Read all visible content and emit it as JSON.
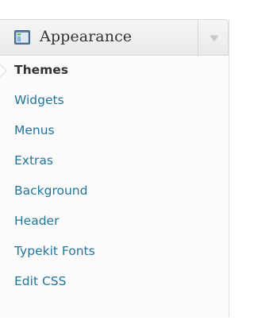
{
  "menu": {
    "title": "Appearance",
    "icon": "appearance-icon",
    "toggle_icon": "chevron-down-icon",
    "colors": {
      "link": "#21759b",
      "current": "#333333",
      "header_top": "#f6f6f6",
      "header_bottom": "#e9e9e9"
    }
  },
  "submenu": {
    "items": [
      {
        "label": "Themes",
        "current": true
      },
      {
        "label": "Widgets"
      },
      {
        "label": "Menus"
      },
      {
        "label": "Extras"
      },
      {
        "label": "Background"
      },
      {
        "label": "Header"
      },
      {
        "label": "Typekit Fonts"
      },
      {
        "label": "Edit CSS"
      }
    ]
  }
}
